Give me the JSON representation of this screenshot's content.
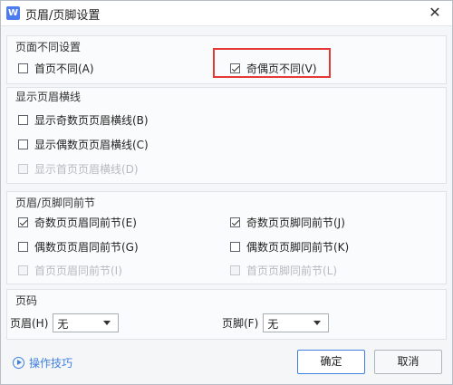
{
  "window": {
    "title": "页眉/页脚设置",
    "app_icon": "W",
    "close": "✕"
  },
  "sections": {
    "diff_page": {
      "title": "页面不同设置",
      "first_page": {
        "label": "首页不同(A)",
        "checked": false
      },
      "odd_even": {
        "label": "奇偶页不同(V)",
        "checked": true
      }
    },
    "header_line": {
      "title": "显示页眉横线",
      "odd": {
        "label": "显示奇数页页眉横线(B)",
        "checked": false
      },
      "even": {
        "label": "显示偶数页页眉横线(C)",
        "checked": false
      },
      "first": {
        "label": "显示首页页眉横线(D)",
        "checked": false
      }
    },
    "link_prev": {
      "title": "页眉/页脚同前节",
      "odd_header": {
        "label": "奇数页页眉同前节(E)",
        "checked": true
      },
      "odd_footer": {
        "label": "奇数页页脚同前节(J)",
        "checked": true
      },
      "even_header": {
        "label": "偶数页页眉同前节(G)",
        "checked": false
      },
      "even_footer": {
        "label": "偶数页页脚同前节(K)",
        "checked": false
      },
      "first_header": {
        "label": "首页页眉同前节(I)",
        "checked": false
      },
      "first_footer": {
        "label": "首页页脚同前节(L)",
        "checked": false
      }
    },
    "page_number": {
      "title": "页码",
      "header": {
        "label": "页眉(H)",
        "value": "无"
      },
      "footer": {
        "label": "页脚(F)",
        "value": "无"
      }
    }
  },
  "footer": {
    "tips_label": "操作技巧",
    "ok_label": "确定",
    "cancel_label": "取消"
  },
  "colors": {
    "accent": "#3f7fe0",
    "highlight": "#e53935"
  }
}
